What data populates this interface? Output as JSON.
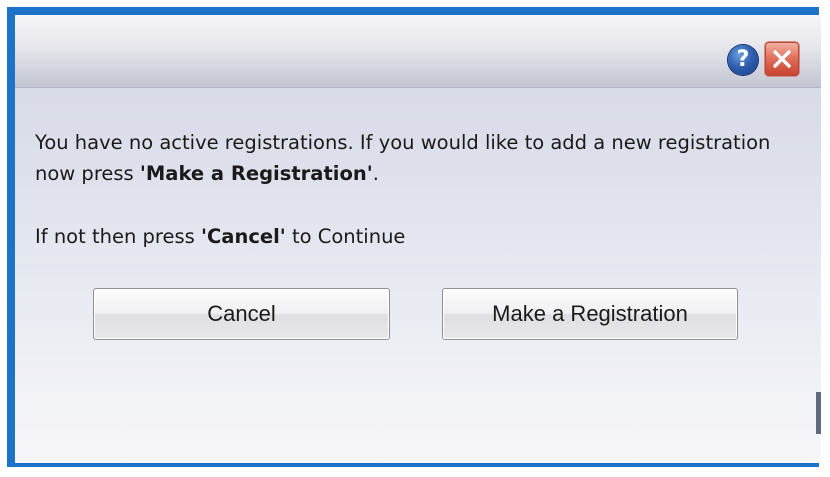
{
  "dialog": {
    "help_icon_label": "?",
    "close_icon": "close-icon",
    "message": {
      "line1_text": "You have no active registrations. If you would like to add a new registration now press ",
      "line1_bold": "'Make a Registration'",
      "line1_end": ".",
      "line2_text_start": "If not then press ",
      "line2_bold": "'Cancel'",
      "line2_text_end": " to Continue"
    },
    "buttons": {
      "cancel_label": "Cancel",
      "register_label": "Make a Registration"
    }
  },
  "colors": {
    "frame_border": "#1d73c9",
    "close_button": "#d9533f",
    "help_button": "#2f5fb1"
  }
}
